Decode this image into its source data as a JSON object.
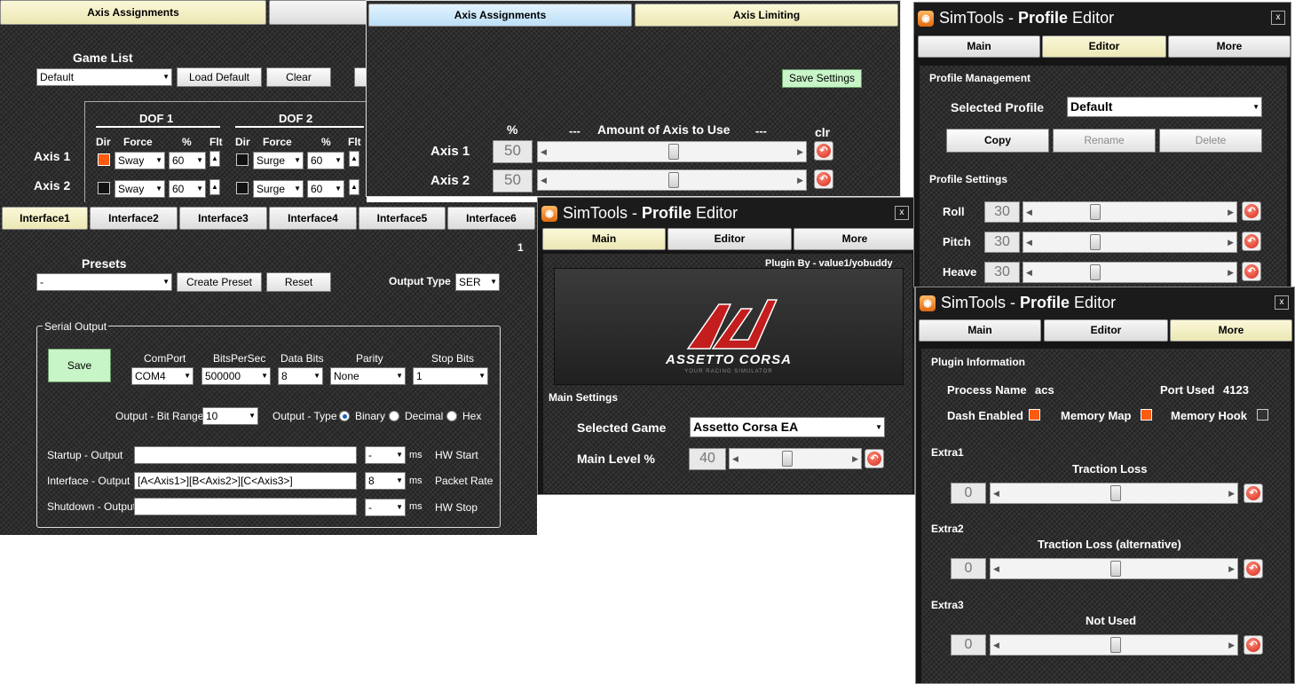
{
  "axis_window": {
    "tabs": [
      "Axis Assignments",
      ""
    ],
    "game_list_label": "Game List",
    "game_list_value": "Default",
    "load_default": "Load Default",
    "clear": "Clear",
    "dof1": "DOF 1",
    "dof2": "DOF 2",
    "col_dir": "Dir",
    "col_force": "Force",
    "col_pct": "%",
    "col_flt": "Flt",
    "rows": [
      {
        "label": "Axis 1",
        "dof1_force": "Sway",
        "dof1_pct": "60",
        "dof2_force": "Surge",
        "dof2_pct": "60"
      },
      {
        "label": "Axis 2",
        "dof1_force": "Sway",
        "dof1_pct": "60",
        "dof2_force": "Surge",
        "dof2_pct": "60"
      }
    ]
  },
  "limit_window": {
    "tabs": [
      "Axis Assignments",
      "Axis Limiting"
    ],
    "save_settings": "Save Settings",
    "col_pct": "%",
    "col_dash_l": "---",
    "col_title": "Amount of Axis to Use",
    "col_dash_r": "---",
    "col_clr": "clr",
    "rows": [
      {
        "label": "Axis 1",
        "value": "50",
        "fill": 0.5
      },
      {
        "label": "Axis 2",
        "value": "50",
        "fill": 0.5
      }
    ]
  },
  "interface_window": {
    "tabs": [
      "Interface1",
      "Interface2",
      "Interface3",
      "Interface4",
      "Interface5",
      "Interface6"
    ],
    "page_num": "1",
    "presets_label": "Presets",
    "presets_value": "-",
    "create_preset": "Create Preset",
    "reset": "Reset",
    "output_type_label": "Output Type",
    "output_type_value": "SER",
    "serial_output": "Serial Output",
    "save": "Save",
    "comport_label": "ComPort",
    "comport_value": "COM4",
    "bps_label": "BitsPerSec",
    "bps_value": "500000",
    "databits_label": "Data Bits",
    "databits_value": "8",
    "parity_label": "Parity",
    "parity_value": "None",
    "stopbits_label": "Stop Bits",
    "stopbits_value": "1",
    "bitrange_label": "Output - Bit Range",
    "bitrange_value": "10",
    "otype_label": "Output - Type",
    "otype_options": [
      "Binary",
      "Decimal",
      "Hex"
    ],
    "startup_label": "Startup - Output",
    "startup_value": "",
    "startup_ms": "-",
    "ms": "ms",
    "hw_start": "HW Start",
    "interface_label": "Interface - Output",
    "interface_value": "[A<Axis1>][B<Axis2>][C<Axis3>]",
    "interface_ms": "8",
    "packet_rate": "Packet Rate",
    "shutdown_label": "Shutdown - Output",
    "shutdown_value": "",
    "shutdown_ms": "-",
    "hw_stop": "HW Stop"
  },
  "main_window": {
    "title_sim": "SimTools",
    "title_dash": " - ",
    "title_profile": "Profile",
    "title_editor": " Editor",
    "close": "x",
    "tabs": [
      "Main",
      "Editor",
      "More"
    ],
    "plugin_by": "Plugin By - value1/yobuddy",
    "logo_text": "ASSETTO CORSA",
    "logo_sub": "YOUR RACING SIMULATOR",
    "main_settings": "Main Settings",
    "selected_game_label": "Selected Game",
    "selected_game_value": "Assetto Corsa EA",
    "main_level_label": "Main Level %",
    "main_level_value": "40",
    "main_level_fill": 0.4
  },
  "editor_window": {
    "title_sim": "SimTools",
    "title_dash": " - ",
    "title_profile": "Profile",
    "title_editor": " Editor",
    "close": "x",
    "tabs": [
      "Main",
      "Editor",
      "More"
    ],
    "profile_mgmt": "Profile Management",
    "selected_profile_label": "Selected Profile",
    "selected_profile_value": "Default",
    "copy": "Copy",
    "rename": "Rename",
    "delete": "Delete",
    "profile_settings": "Profile Settings",
    "rows": [
      {
        "label": "Roll",
        "value": "30",
        "fill": 0.3
      },
      {
        "label": "Pitch",
        "value": "30",
        "fill": 0.3
      },
      {
        "label": "Heave",
        "value": "30",
        "fill": 0.3
      }
    ]
  },
  "more_window": {
    "title_sim": "SimTools",
    "title_dash": " - ",
    "title_profile": "Profile",
    "title_editor": " Editor",
    "close": "x",
    "tabs": [
      "Main",
      "Editor",
      "More"
    ],
    "plugin_info": "Plugin Information",
    "process_name_label": "Process Name",
    "process_name_value": "acs",
    "port_used_label": "Port Used",
    "port_used_value": "4123",
    "dash_enabled": "Dash Enabled",
    "memory_map": "Memory Map",
    "memory_hook": "Memory Hook",
    "extras": [
      {
        "head": "Extra1",
        "name": "Traction Loss",
        "value": "0",
        "fill": 0.5
      },
      {
        "head": "Extra2",
        "name": "Traction Loss (alternative)",
        "value": "0",
        "fill": 0.5
      },
      {
        "head": "Extra3",
        "name": "Not Used",
        "value": "0",
        "fill": 0.5
      }
    ]
  },
  "colors": {
    "accent_orange": "#ff5a10",
    "active_tab": "#ece7b4",
    "save_green": "#c8f5c8"
  }
}
